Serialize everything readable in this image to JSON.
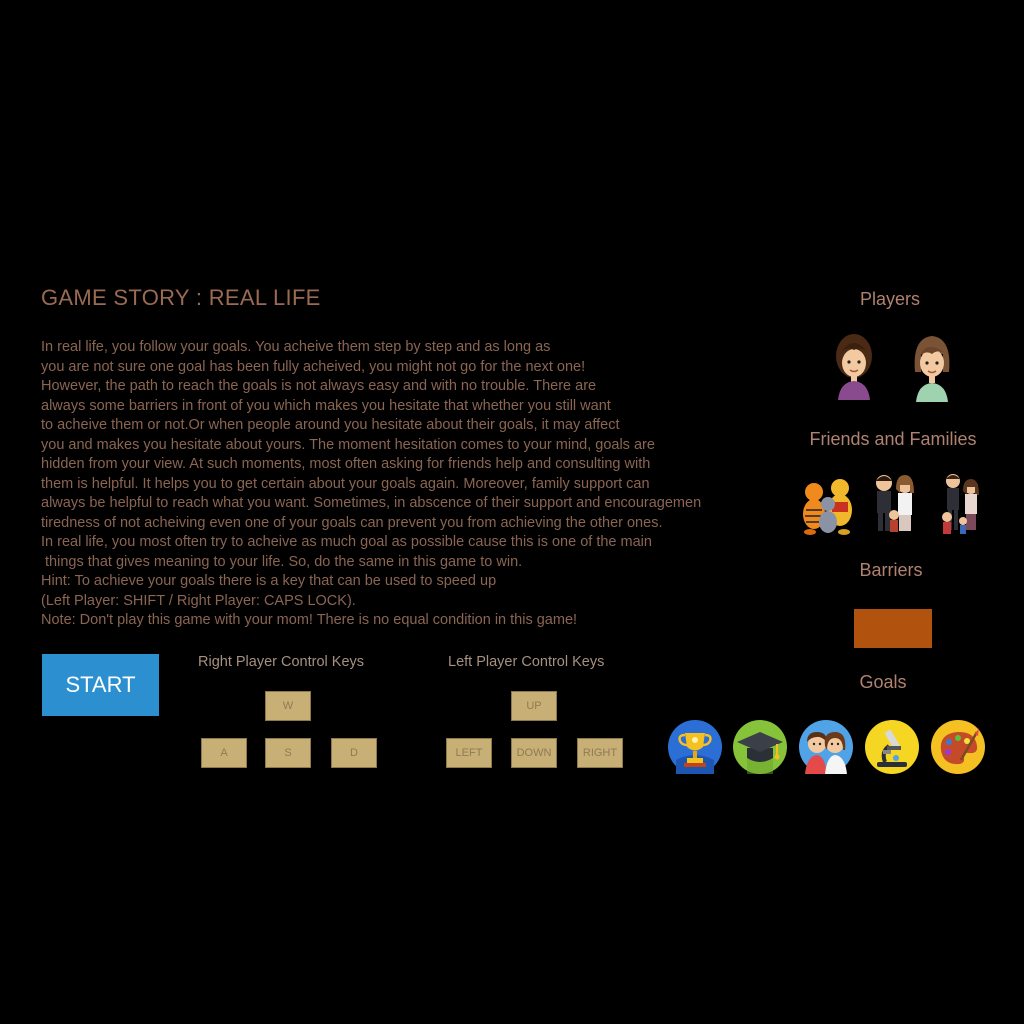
{
  "story": {
    "title": "GAME STORY : REAL LIFE",
    "lines": [
      "In real life, you follow your goals. You acheive them step by step and as long as",
      "you are not sure one goal has been fully acheived, you might not go for the next one!",
      "However, the path to reach the goals is not always easy and with no trouble. There are",
      "always some barriers in front of you which makes you hesitate that whether you still want",
      "to acheive them or not.Or when people around you hesitate about their goals, it may affect",
      "you and makes you hesitate about yours. The moment hesitation comes to your mind, goals are",
      "hidden from your view. At such moments, most often asking for friends help and consulting with",
      "them is helpful. It helps you to get certain about your goals again. Moreover, family support can",
      "always be helpful to reach what you want. Sometimes, in abscence of their support and encouragemen",
      "tiredness of not acheiving even one of your goals can prevent you from achieving the other ones.",
      "In real life, you most often try to acheive as much goal as possible cause this is one of the main",
      " things that gives meaning to your life. So, do the same in this game to win.",
      "Hint: To achieve your goals there is a key that can be used to speed up",
      "(Left Player: SHIFT / Right Player: CAPS LOCK).",
      "Note: Don't play this game with your mom! There is no equal condition in this game!"
    ]
  },
  "start_button": {
    "label": "START"
  },
  "right_controls": {
    "title": "Right Player Control Keys",
    "up": "W",
    "left": "A",
    "down": "S",
    "right": "D"
  },
  "left_controls": {
    "title": "Left Player Control Keys",
    "up": "UP",
    "left": "LEFT",
    "down": "DOWN",
    "right": "RIGHT"
  },
  "sidebar": {
    "players_title": "Players",
    "friends_title": "Friends and Families",
    "barriers_title": "Barriers",
    "goals_title": "Goals"
  },
  "icons": {
    "players": [
      "boy-player-icon",
      "girl-player-icon"
    ],
    "friends": [
      "cartoon-friends-icon",
      "family-icon",
      "family-with-child-icon"
    ],
    "goals": [
      "trophy-icon",
      "graduation-cap-icon",
      "couple-icon",
      "microscope-icon",
      "paint-palette-icon"
    ]
  },
  "colors": {
    "background": "#000000",
    "start_button": "#2b8fd0",
    "key": "#c8af75",
    "barrier": "#b1520f",
    "title_text": "#9a6a52"
  }
}
